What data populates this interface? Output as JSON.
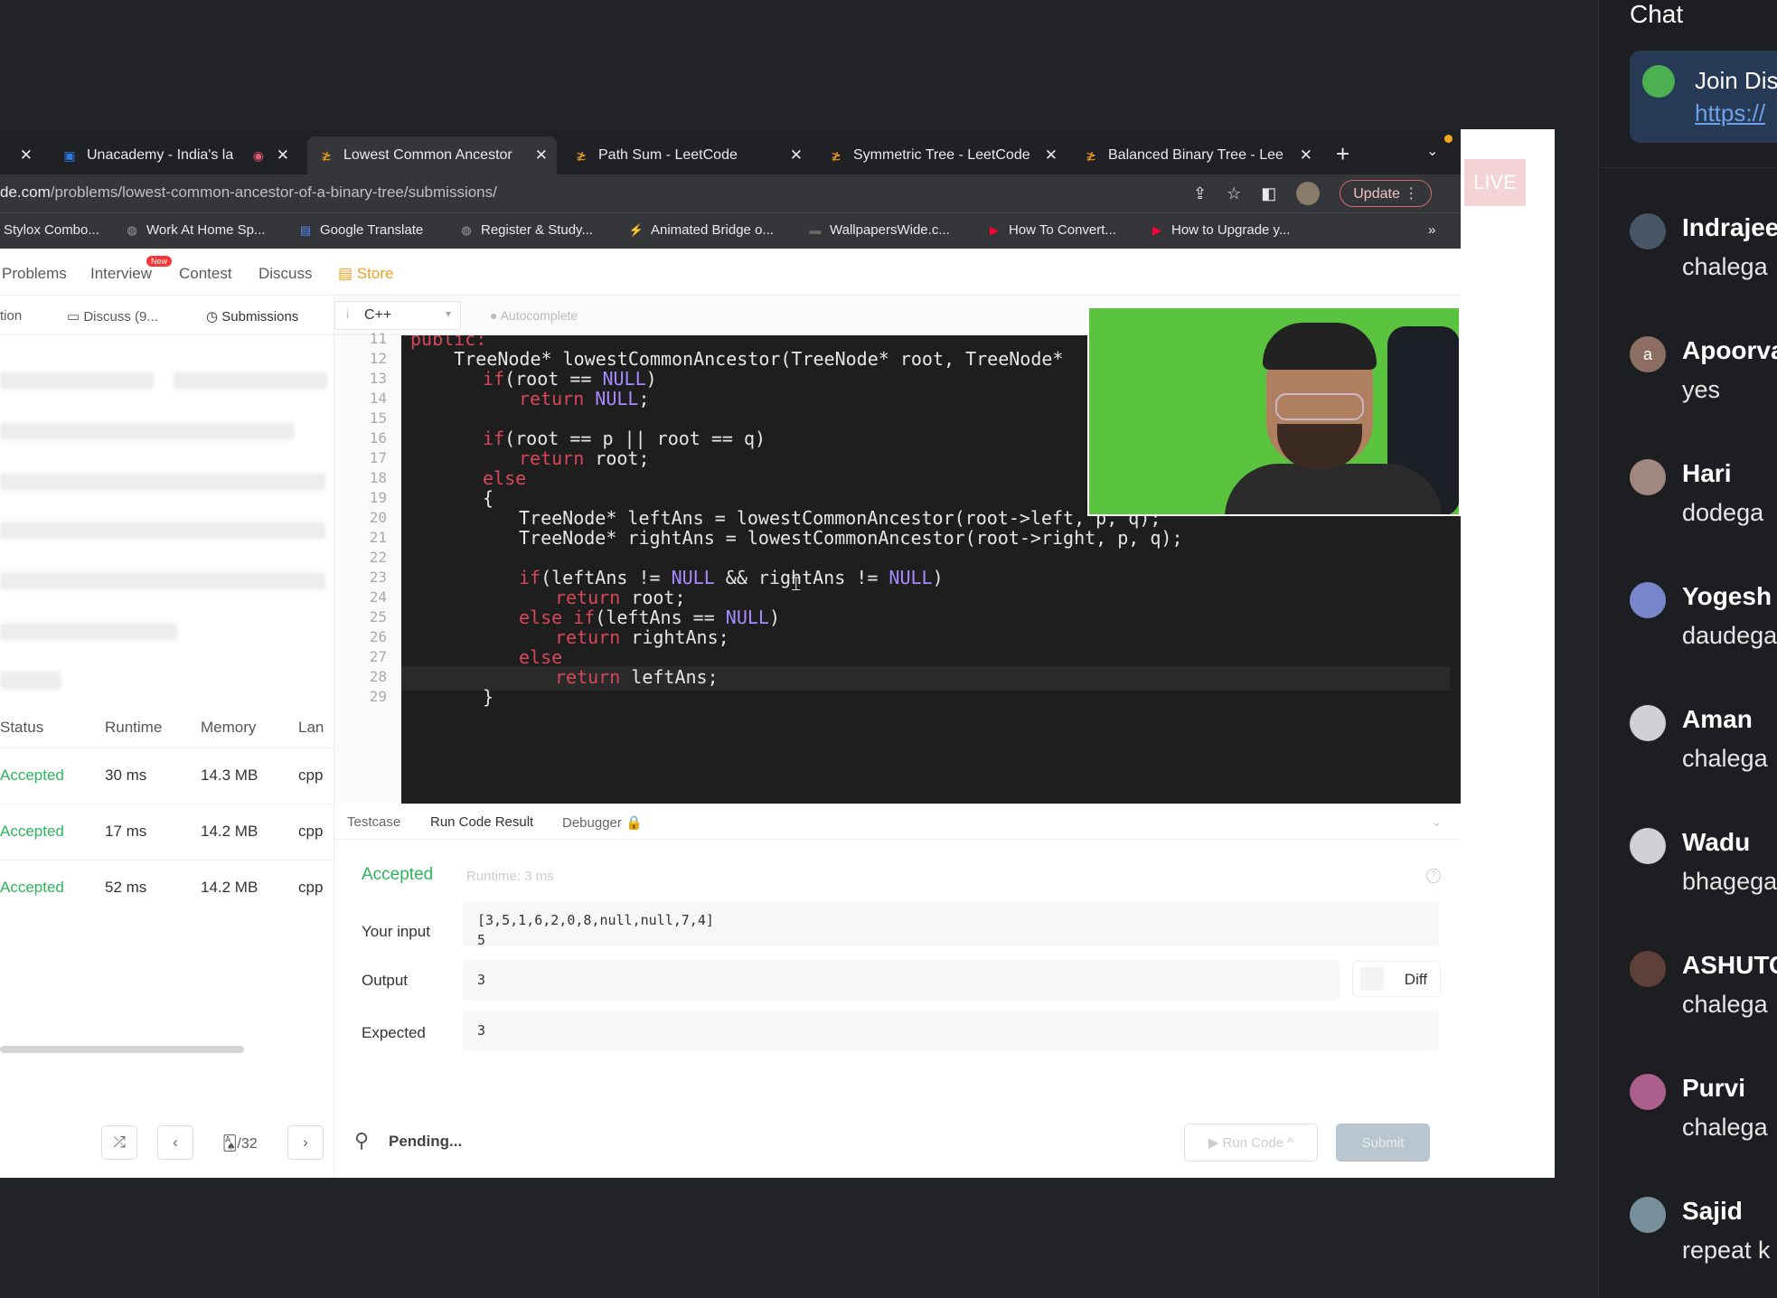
{
  "browser": {
    "tabs": [
      {
        "title": "",
        "active": false
      },
      {
        "title": "Unacademy - India's la",
        "active": false
      },
      {
        "title": "Lowest Common Ancestor",
        "active": true
      },
      {
        "title": "Path Sum - LeetCode",
        "active": false
      },
      {
        "title": "Symmetric Tree - LeetCode",
        "active": false
      },
      {
        "title": "Balanced Binary Tree - Lee",
        "active": false
      }
    ],
    "url_host": "de.com",
    "url_path": "/problems/lowest-common-ancestor-of-a-binary-tree/submissions/",
    "update_label": "Update",
    "bookmarks": [
      "Stylox Combo...",
      "Work At Home Sp...",
      "Google Translate",
      "Register & Study...",
      "Animated Bridge o...",
      "WallpapersWide.c...",
      "How To Convert...",
      "How to Upgrade y..."
    ]
  },
  "live_label": "LIVE",
  "leetcode": {
    "nav": [
      "Problems",
      "Interview",
      "Contest",
      "Discuss",
      "Store"
    ],
    "new_badge": "New",
    "left_tabs": [
      "tion",
      "Discuss (9...",
      "Submissions"
    ],
    "table": {
      "headers": [
        "Status",
        "Runtime",
        "Memory",
        "Lan"
      ],
      "rows": [
        {
          "status": "Accepted",
          "runtime": "30 ms",
          "memory": "14.3 MB",
          "lang": "cpp"
        },
        {
          "status": "Accepted",
          "runtime": "17 ms",
          "memory": "14.2 MB",
          "lang": "cpp"
        },
        {
          "status": "Accepted",
          "runtime": "52 ms",
          "memory": "14.2 MB",
          "lang": "cpp"
        }
      ]
    },
    "pagination": "🂡/32",
    "language": "C++",
    "autocomplete": "Autocomplete",
    "line_numbers": [
      "11",
      "12",
      "13",
      "14",
      "15",
      "16",
      "17",
      "18",
      "19",
      "20",
      "21",
      "22",
      "23",
      "24",
      "25",
      "26",
      "27",
      "28",
      "29"
    ],
    "code": {
      "l11": "public:",
      "l12": "    TreeNode* lowestCommonAncestor(TreeNode* root, TreeNode*",
      "l13a": "if",
      "l13b": "(root == ",
      "l13c": "NULL",
      "l13d": ")",
      "l14a": "return",
      "l14b": "NULL",
      "l14c": ";",
      "l16a": "if",
      "l16b": "(root == p || root == q)",
      "l17a": "return",
      "l17b": " root;",
      "l18": "else",
      "l19": "{",
      "l20": "TreeNode* leftAns = lowestCommonAncestor(root->left, p, q);",
      "l21": "TreeNode* rightAns = lowestCommonAncestor(root->right, p, q);",
      "l23a": "if",
      "l23b": "(leftAns != ",
      "l23c": "NULL",
      "l23d": " && rightAns != ",
      "l23e": "NULL",
      "l23f": ")",
      "l24a": "return",
      "l24b": " root;",
      "l25a": "else if",
      "l25b": "(leftAns == ",
      "l25c": "NULL",
      "l25d": ")",
      "l26a": "return",
      "l26b": " rightAns;",
      "l27": "else",
      "l28a": "return",
      "l28b": " leftAns;",
      "l29": "}"
    },
    "result_tabs": [
      "Testcase",
      "Run Code Result",
      "Debugger"
    ],
    "result": {
      "status": "Accepted",
      "runtime": "Runtime: 3 ms",
      "input_label": "Your input",
      "input_line1": "[3,5,1,6,2,0,8,null,null,7,4]",
      "input_line2": "5",
      "output_label": "Output",
      "output_value": "3",
      "expected_label": "Expected",
      "expected_value": "3",
      "diff_label": "Diff"
    },
    "pending": "Pending...",
    "run_code": "▶ Run Code ^",
    "submit": "Submit"
  },
  "chat": {
    "title": "Chat",
    "pinned_line1": "Join Dis",
    "pinned_line2": "https://",
    "messages": [
      {
        "name": "Indrajee",
        "text": "chalega",
        "initial": ""
      },
      {
        "name": "Apoorva",
        "text": "yes",
        "initial": "a"
      },
      {
        "name": "Hari",
        "text": "dodega",
        "initial": ""
      },
      {
        "name": "Yogesh",
        "text": "daudega",
        "initial": ""
      },
      {
        "name": "Aman",
        "text": "chalega",
        "initial": ""
      },
      {
        "name": "Wadu",
        "text": "bhagega",
        "initial": ""
      },
      {
        "name": "ASHUTO",
        "text": "chalega",
        "initial": ""
      },
      {
        "name": "Purvi",
        "text": "chalega",
        "initial": ""
      },
      {
        "name": "Sajid",
        "text": "repeat k",
        "initial": ""
      }
    ]
  },
  "colors": {
    "accepted": "#2db55d",
    "keyword": "#d7465a",
    "null": "#a58bff",
    "link": "#6ea2e8"
  }
}
